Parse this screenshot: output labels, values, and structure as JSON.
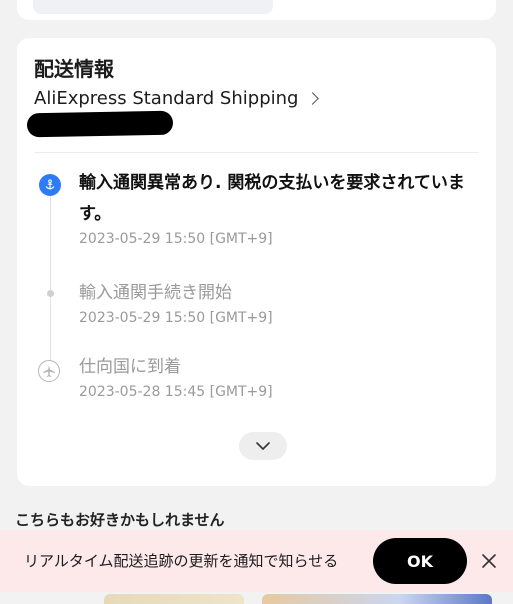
{
  "shipping": {
    "title": "配送情報",
    "carrier": "AliExpress Standard Shipping",
    "events": [
      {
        "title": "輸入通関異常あり. 関税の支払いを要求されています。",
        "time": "2023-05-29 15:50 [GMT+9]",
        "icon": "anchor-icon",
        "state": "active"
      },
      {
        "title": "輸入通関手続き開始",
        "time": "2023-05-29 15:50 [GMT+9]",
        "icon": "dot-icon",
        "state": "past"
      },
      {
        "title": "仕向国に到着",
        "time": "2023-05-28 15:45 [GMT+9]",
        "icon": "airplane-icon",
        "state": "past"
      }
    ]
  },
  "recommend": {
    "title": "こちらもお好きかもしれません"
  },
  "banner": {
    "text": "リアルタイム配送追跡の更新を通知で知らせる",
    "ok_label": "OK"
  },
  "colors": {
    "accent_blue": "#2e7bf6",
    "banner_bg": "#fde8ea",
    "muted_text": "#9a9a9a"
  }
}
